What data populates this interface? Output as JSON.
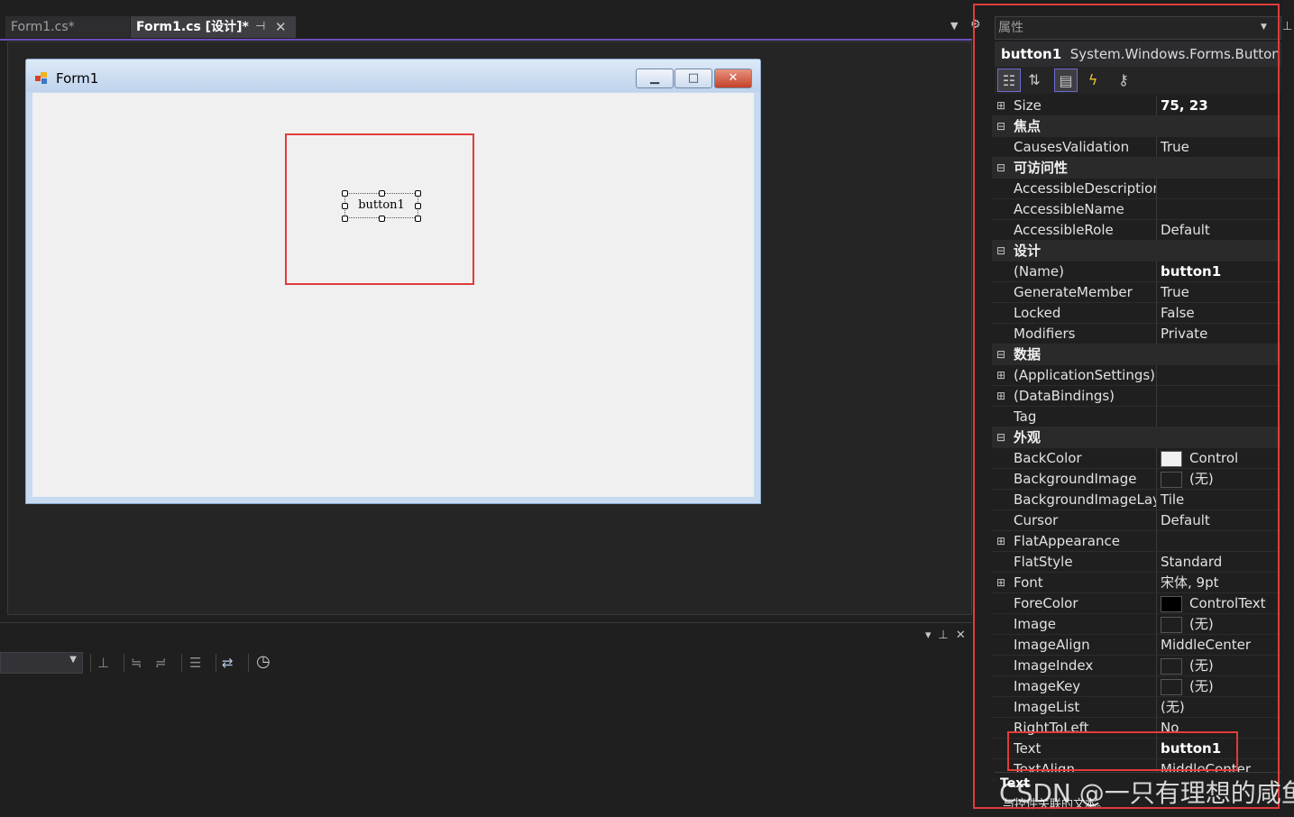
{
  "tabs": [
    {
      "label": "Form1.cs*",
      "active": false
    },
    {
      "label": "Form1.cs [设计]*",
      "active": true
    }
  ],
  "designer": {
    "form_title": "Form1",
    "button_text": "button1"
  },
  "properties": {
    "header": "属性",
    "object_name": "button1",
    "object_type": "System.Windows.Forms.Button",
    "toolbar_icons": [
      "categorized-icon",
      "alphabetical-icon",
      "properties-icon",
      "events-icon",
      "property-pages-icon"
    ],
    "rows": [
      {
        "kind": "prop",
        "expand": "⊞",
        "name": "Size",
        "value": "75, 23",
        "bold": true
      },
      {
        "kind": "cat",
        "expand": "⊟",
        "name": "焦点"
      },
      {
        "kind": "prop",
        "name": "CausesValidation",
        "value": "True"
      },
      {
        "kind": "cat",
        "expand": "⊟",
        "name": "可访问性"
      },
      {
        "kind": "prop",
        "name": "AccessibleDescription",
        "value": ""
      },
      {
        "kind": "prop",
        "name": "AccessibleName",
        "value": ""
      },
      {
        "kind": "prop",
        "name": "AccessibleRole",
        "value": "Default"
      },
      {
        "kind": "cat",
        "expand": "⊟",
        "name": "设计"
      },
      {
        "kind": "prop",
        "name": "(Name)",
        "value": "button1",
        "bold": true
      },
      {
        "kind": "prop",
        "name": "GenerateMember",
        "value": "True"
      },
      {
        "kind": "prop",
        "name": "Locked",
        "value": "False"
      },
      {
        "kind": "prop",
        "name": "Modifiers",
        "value": "Private"
      },
      {
        "kind": "cat",
        "expand": "⊟",
        "name": "数据"
      },
      {
        "kind": "prop",
        "expand": "⊞",
        "name": "(ApplicationSettings)",
        "value": ""
      },
      {
        "kind": "prop",
        "expand": "⊞",
        "name": "(DataBindings)",
        "value": ""
      },
      {
        "kind": "prop",
        "name": "Tag",
        "value": ""
      },
      {
        "kind": "cat",
        "expand": "⊟",
        "name": "外观"
      },
      {
        "kind": "prop",
        "name": "BackColor",
        "value": "Control",
        "swatch": "#f0f0f0"
      },
      {
        "kind": "prop",
        "name": "BackgroundImage",
        "value": "(无)",
        "swatch": "#1f1f1f"
      },
      {
        "kind": "prop",
        "name": "BackgroundImageLayout",
        "value": "Tile"
      },
      {
        "kind": "prop",
        "name": "Cursor",
        "value": "Default"
      },
      {
        "kind": "prop",
        "expand": "⊞",
        "name": "FlatAppearance",
        "value": ""
      },
      {
        "kind": "prop",
        "name": "FlatStyle",
        "value": "Standard"
      },
      {
        "kind": "prop",
        "expand": "⊞",
        "name": "Font",
        "value": "宋体, 9pt"
      },
      {
        "kind": "prop",
        "name": "ForeColor",
        "value": "ControlText",
        "swatch": "#000000"
      },
      {
        "kind": "prop",
        "name": "Image",
        "value": "(无)",
        "swatch": "#1f1f1f"
      },
      {
        "kind": "prop",
        "name": "ImageAlign",
        "value": "MiddleCenter"
      },
      {
        "kind": "prop",
        "name": "ImageIndex",
        "value": "(无)",
        "swatch": "#1f1f1f"
      },
      {
        "kind": "prop",
        "name": "ImageKey",
        "value": "(无)",
        "swatch": "#1f1f1f"
      },
      {
        "kind": "prop",
        "name": "ImageList",
        "value": "(无)"
      },
      {
        "kind": "prop",
        "name": "RightToLeft",
        "value": "No"
      },
      {
        "kind": "prop",
        "name": "Text",
        "value": "button1",
        "bold": true
      },
      {
        "kind": "prop",
        "name": "TextAlign",
        "value": "MiddleCenter"
      }
    ],
    "description_title": "Text",
    "description_text": "与控件关联的文本。"
  },
  "watermark": "CSDN @一只有理想的咸鱼",
  "colors": {
    "highlight": "#e23b3b",
    "tab_accent": "#6b4fbb"
  }
}
